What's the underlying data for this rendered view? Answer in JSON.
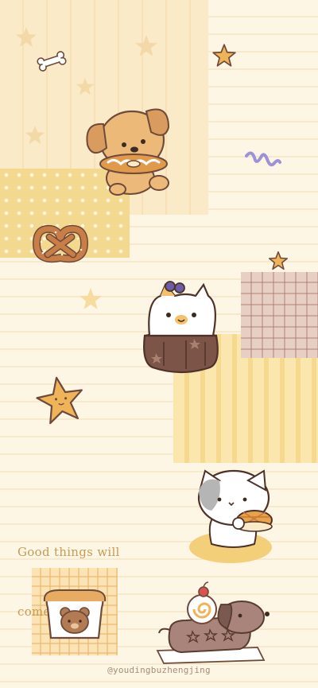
{
  "wallpaper": {
    "quote_line1": "Good things will",
    "quote_line2": "come to me.",
    "credit": "@youdingbuzhengjing"
  },
  "colors": {
    "background": "#fdf6e4",
    "accent_gold": "#f0b458",
    "brown": "#6e4a3a",
    "text": "#c99a55"
  },
  "illustrations": [
    "puppy-with-donut",
    "pretzel",
    "cat-in-cake",
    "cat-eating-pancake",
    "bear-toast",
    "dachshund-with-roll-cake",
    "bone",
    "stars",
    "ribbon"
  ]
}
